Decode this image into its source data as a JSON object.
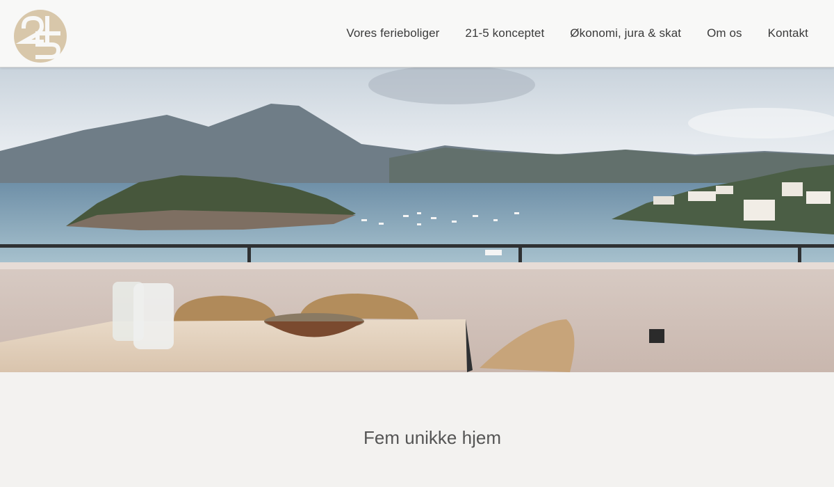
{
  "brand": {
    "logo_text": "21-5",
    "logo_color": "#d8c7aa"
  },
  "nav": {
    "items": [
      {
        "label": "Vores ferieboliger"
      },
      {
        "label": "21-5 konceptet"
      },
      {
        "label": "Økonomi, jura & skat"
      },
      {
        "label": "Om os"
      },
      {
        "label": "Kontakt"
      }
    ]
  },
  "hero": {
    "description_icon": "hero-photo"
  },
  "main": {
    "title": "Fem unikke hjem"
  },
  "colors": {
    "header_bg": "#f8f8f7",
    "page_bg": "#f3f2f0",
    "accent": "#d8c7aa"
  }
}
